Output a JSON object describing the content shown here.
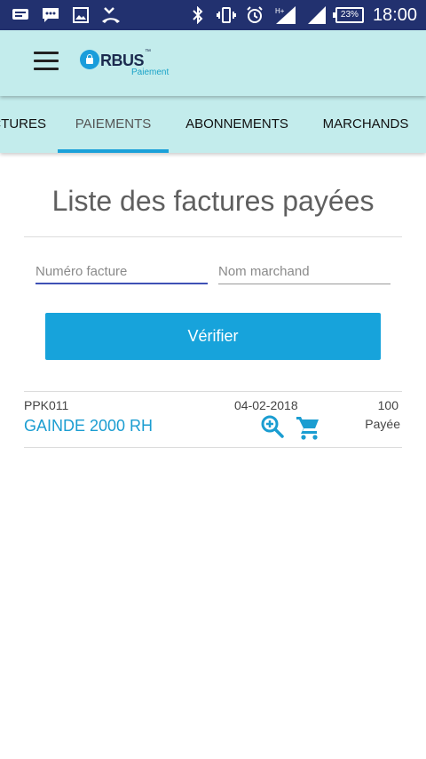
{
  "status_bar": {
    "time": "18:00",
    "battery": "23%",
    "network": "H+",
    "icons": [
      "message-icon",
      "chat-icon",
      "image-icon",
      "missed-call-icon",
      "bluetooth-icon",
      "vibrate-icon",
      "alarm-icon",
      "signal-icon",
      "wifi-signal-icon",
      "battery-icon"
    ]
  },
  "app_bar": {
    "logo_brand": "RBUS",
    "logo_tm": "™",
    "logo_sub": "Paiement",
    "menu_icon": "hamburger-menu-icon"
  },
  "tabs": [
    {
      "label": "FACTURES",
      "active": false
    },
    {
      "label": "PAIEMENTS",
      "active": true
    },
    {
      "label": "ABONNEMENTS",
      "active": false
    },
    {
      "label": "MARCHANDS",
      "active": false
    }
  ],
  "page": {
    "title": "Liste des factures payées"
  },
  "search": {
    "invoice_placeholder": "Numéro facture",
    "merchant_placeholder": "Nom marchand",
    "verify_label": "Vérifier"
  },
  "invoices": [
    {
      "reference": "PPK011",
      "name": "GAINDE 2000 RH",
      "date": "04-02-2018",
      "amount": "100",
      "status": "Payée"
    }
  ],
  "colors": {
    "status_bar": "#22316f",
    "app_bar": "#c3ecec",
    "accent": "#17a3db",
    "focus_underline": "#3f51b5"
  }
}
